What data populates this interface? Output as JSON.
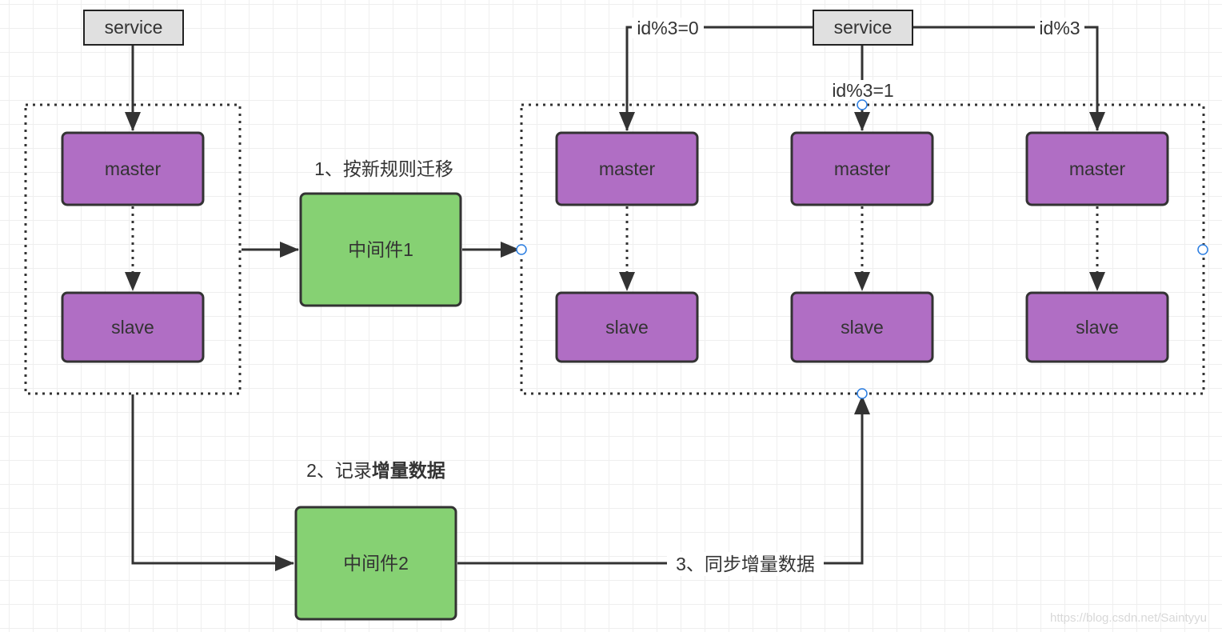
{
  "colors": {
    "db_node": "#B06EC4",
    "middleware": "#86D173",
    "service": "#E0E0E0",
    "stroke": "#333333"
  },
  "left": {
    "service": "service",
    "master": "master",
    "slave": "slave"
  },
  "middleware1": {
    "label": "中间件1",
    "step": "1、按新规则迁移"
  },
  "middleware2": {
    "label": "中间件2",
    "step_prefix": "2、记录",
    "step_bold": "增量数据"
  },
  "right": {
    "service": "service",
    "route0": "id%3=0",
    "route1": "id%3=1",
    "route2": "id%3",
    "shards": [
      {
        "master": "master",
        "slave": "slave"
      },
      {
        "master": "master",
        "slave": "slave"
      },
      {
        "master": "master",
        "slave": "slave"
      }
    ]
  },
  "sync": {
    "step": "3、同步增量数据"
  },
  "watermark": "https://blog.csdn.net/Saintyyu"
}
